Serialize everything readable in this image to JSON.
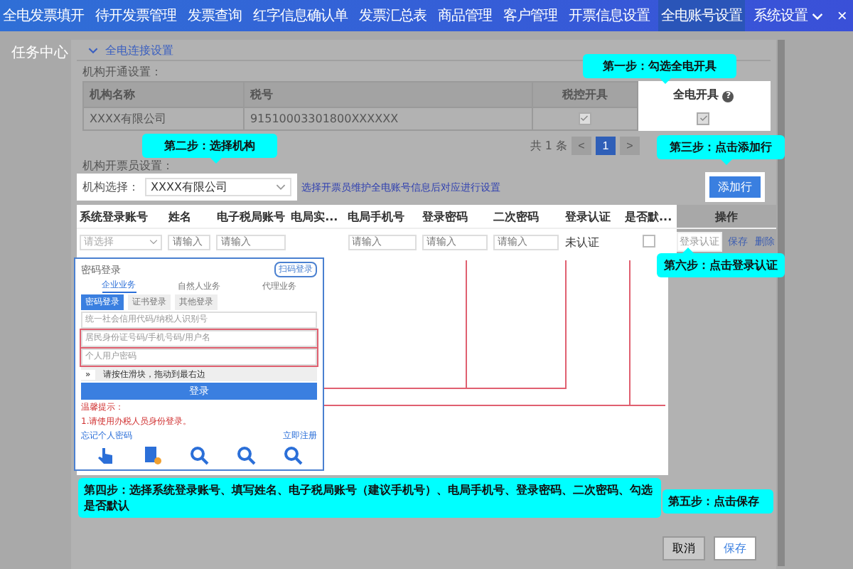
{
  "nav": {
    "items": [
      {
        "label": "全电发票填开",
        "selected": false
      },
      {
        "label": "待开发票管理",
        "selected": false
      },
      {
        "label": "发票查询",
        "selected": false
      },
      {
        "label": "红字信息确认单",
        "selected": false
      },
      {
        "label": "发票汇总表",
        "selected": false
      },
      {
        "label": "商品管理",
        "selected": false
      },
      {
        "label": "客户管理",
        "selected": false
      },
      {
        "label": "开票信息设置",
        "selected": false
      },
      {
        "label": "全电账号设置",
        "selected": true
      },
      {
        "label": "系统设置",
        "selected": false,
        "dropdown": true
      }
    ],
    "close": "×"
  },
  "sidebar": {
    "label": "任务中心"
  },
  "section": {
    "title": "全电连接设置",
    "expanded": true
  },
  "org_settings": {
    "label": "机构开通设置：",
    "columns": [
      "机构名称",
      "税号",
      "税控开具",
      "全电开具"
    ],
    "rows": [
      {
        "name": "XXXX有限公司",
        "tax_id": "91510003301800XXXXXX",
        "tax_control": true,
        "all_electric": true
      }
    ],
    "help": "?",
    "pagination": {
      "total": "共 1 条",
      "prev": "<",
      "pages": [
        {
          "label": "1",
          "selected": true
        }
      ],
      "next": ">"
    }
  },
  "operators": {
    "label": "机构开票员设置：",
    "org_select": {
      "label": "机构选择：",
      "value": "XXXX有限公司"
    },
    "hint": "选择开票员维护全电账号信息后对应进行设置",
    "add_button": "添加行",
    "columns": [
      "系统登录账号",
      "姓名",
      "电子税局账号",
      "电局实...",
      "电局手机号",
      "登录密码",
      "二次密码",
      "登录认证",
      "是否默...",
      "操作"
    ],
    "row": {
      "account_placeholder": "请选择",
      "name_placeholder": "请输入",
      "etax_placeholder": "请输入",
      "phone_placeholder": "请输入",
      "password_placeholder": "请输入",
      "second_placeholder": "请输入",
      "auth_status": "未认证",
      "default": false,
      "actions": [
        "登录认证",
        "保存",
        "删除"
      ]
    }
  },
  "login_panel": {
    "title": "密码登录",
    "badge": "扫码登录",
    "tabs": [
      {
        "label": "企业业务",
        "selected": true
      },
      {
        "label": "自然人业务",
        "selected": false
      },
      {
        "label": "代理业务",
        "selected": false
      }
    ],
    "methods": [
      {
        "label": "密码登录",
        "selected": true
      },
      {
        "label": "证书登录",
        "selected": false
      },
      {
        "label": "其他登录",
        "selected": false
      }
    ],
    "fields": [
      {
        "placeholder": "统一社会信用代码/纳税人识别号",
        "highlighted": false
      },
      {
        "placeholder": "居民身份证号码/手机号码/用户名",
        "highlighted": true
      },
      {
        "placeholder": "个人用户密码",
        "highlighted": true
      }
    ],
    "slider_knob": "»",
    "slider": "请按住滑块，拖动到最右边",
    "button": "登录",
    "tips_title": "温馨提示：",
    "tips": "1.请使用办税人员身份登录。",
    "links": [
      "忘记个人密码",
      "立即注册"
    ]
  },
  "callouts": [
    {
      "text": "第一步：勾选全电开具"
    },
    {
      "text": "第二步：选择机构"
    },
    {
      "text": "第三步：点击添加行"
    },
    {
      "text": "第六步：点击登录认证"
    },
    {
      "text": "第四步：选择系统登录账号、填写姓名、电子税局账号（建议手机号）、电局手机号、登录密码、二次密码、勾选是否默认"
    },
    {
      "text": "第五步：点击保存"
    }
  ],
  "footer": [
    "取消",
    "保存"
  ]
}
